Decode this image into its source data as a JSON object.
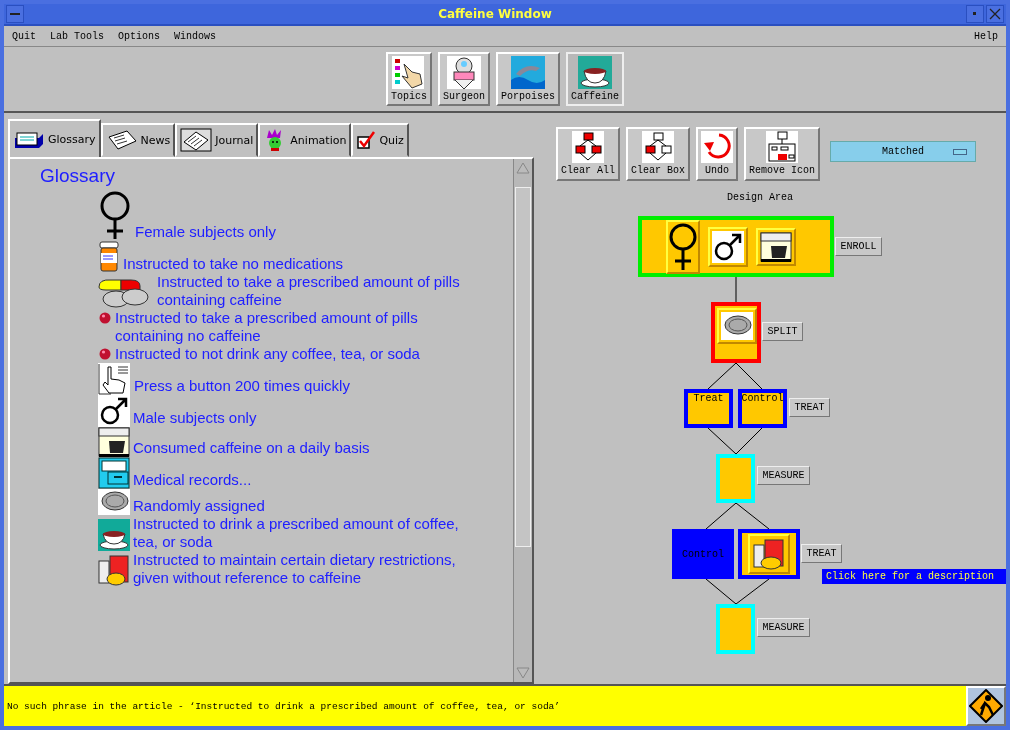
{
  "window": {
    "title": "Caffeine Window"
  },
  "menu": {
    "items": [
      "Quit",
      "Lab Tools",
      "Options",
      "Windows"
    ],
    "help": "Help"
  },
  "toolbar": [
    {
      "label": "Topics",
      "kind": "topics",
      "selected": false
    },
    {
      "label": "Surgeon",
      "kind": "surgeon",
      "selected": false
    },
    {
      "label": "Porpoises",
      "kind": "porpoises",
      "selected": false
    },
    {
      "label": "Caffeine",
      "kind": "caffeine",
      "selected": true
    }
  ],
  "tabs": [
    {
      "label": "Glossary",
      "kind": "glossary",
      "selected": true
    },
    {
      "label": "News",
      "kind": "news",
      "selected": false
    },
    {
      "label": "Journal",
      "kind": "journal",
      "selected": false
    },
    {
      "label": "Animation",
      "kind": "animation",
      "selected": false
    },
    {
      "label": "Quiz",
      "kind": "quiz",
      "selected": false
    }
  ],
  "glossary": {
    "heading": "Glossary",
    "entries": [
      {
        "kind": "female",
        "text": "Female subjects only"
      },
      {
        "kind": "pill-bottle",
        "text": "Instructed to take no medications"
      },
      {
        "kind": "pills",
        "text": "Instructed to take a prescribed amount of pills containing caffeine"
      },
      {
        "kind": "bullet",
        "text": "Instructed to take a prescribed amount of pills containing no caffeine"
      },
      {
        "kind": "bullet",
        "text": "Instructed to not drink any coffee, tea, or soda"
      },
      {
        "kind": "pointer",
        "text": "Press a button 200 times quickly"
      },
      {
        "kind": "male",
        "text": "Male subjects only"
      },
      {
        "kind": "coffee-maker",
        "text": "Consumed caffeine on a daily basis"
      },
      {
        "kind": "records",
        "text": "Medical records..."
      },
      {
        "kind": "coin",
        "text": "Randomly assigned"
      },
      {
        "kind": "cup",
        "text": "Instructed to drink a prescribed amount of coffee, tea, or soda"
      },
      {
        "kind": "food",
        "text": "Instructed to maintain certain dietary restrictions, given without reference to caffeine"
      }
    ]
  },
  "design_tools": [
    {
      "label": "Clear All",
      "kind": "clear-all"
    },
    {
      "label": "Clear Box",
      "kind": "clear-box"
    },
    {
      "label": "Undo",
      "kind": "undo"
    },
    {
      "label": "Remove Icon",
      "kind": "remove-icon"
    }
  ],
  "match_dropdown": {
    "value": "Matched"
  },
  "design_area": {
    "label": "Design Area",
    "steps": [
      {
        "kind": "enroll",
        "label": "ENROLL",
        "boxes": [
          {
            "kind": "female"
          },
          {
            "kind": "male"
          },
          {
            "kind": "coffee-maker"
          }
        ]
      },
      {
        "kind": "split",
        "label": "SPLIT",
        "boxes": [
          {
            "kind": "coin"
          }
        ]
      },
      {
        "kind": "treat",
        "label": "TREAT",
        "boxes": [
          {
            "kind": "text",
            "text": "Treat"
          },
          {
            "kind": "text",
            "text": "Control"
          }
        ]
      },
      {
        "kind": "measure",
        "label": "MEASURE"
      },
      {
        "kind": "treat",
        "label": "TREAT",
        "boxes": [
          {
            "kind": "filled",
            "text": "Control"
          },
          {
            "kind": "food"
          }
        ]
      },
      {
        "kind": "measure",
        "label": "MEASURE"
      }
    ],
    "tooltip": "Click here for a description"
  },
  "status_bar": {
    "message": "No such phrase in the article - ‘Instructed to drink a prescribed amount of coffee, tea, or soda’"
  }
}
